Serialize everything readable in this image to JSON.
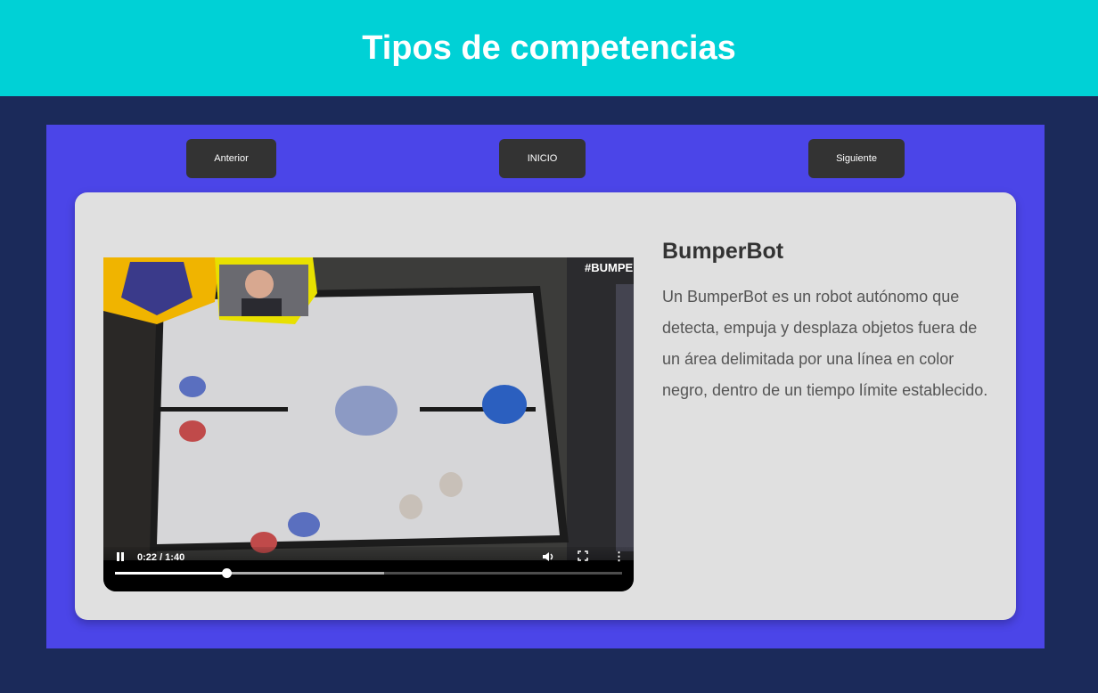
{
  "header": {
    "title": "Tipos de competencias"
  },
  "nav": {
    "prev_label": "Anterior",
    "home_label": "INICIO",
    "next_label": "Siguiente"
  },
  "competition": {
    "name": "BumperBot",
    "description": "Un BumperBot es un robot autónomo que detecta, empuja y desplaza objetos fuera de un área delimitada por una línea en color negro, dentro de un tiempo límite establecido."
  },
  "video": {
    "time_display": "0:22 / 1:40",
    "progress": 0.22,
    "buffered": 0.53,
    "overlay_tag": "#BUMPE",
    "icons": [
      "pause-icon",
      "volume-icon",
      "fullscreen-icon",
      "more-options-icon"
    ]
  },
  "colors": {
    "header_bg": "#00d1d6",
    "page_bg": "#1b2a5a",
    "panel_bg": "#4b45e8",
    "card_bg": "#e0e0e0",
    "button_bg": "#333333"
  }
}
